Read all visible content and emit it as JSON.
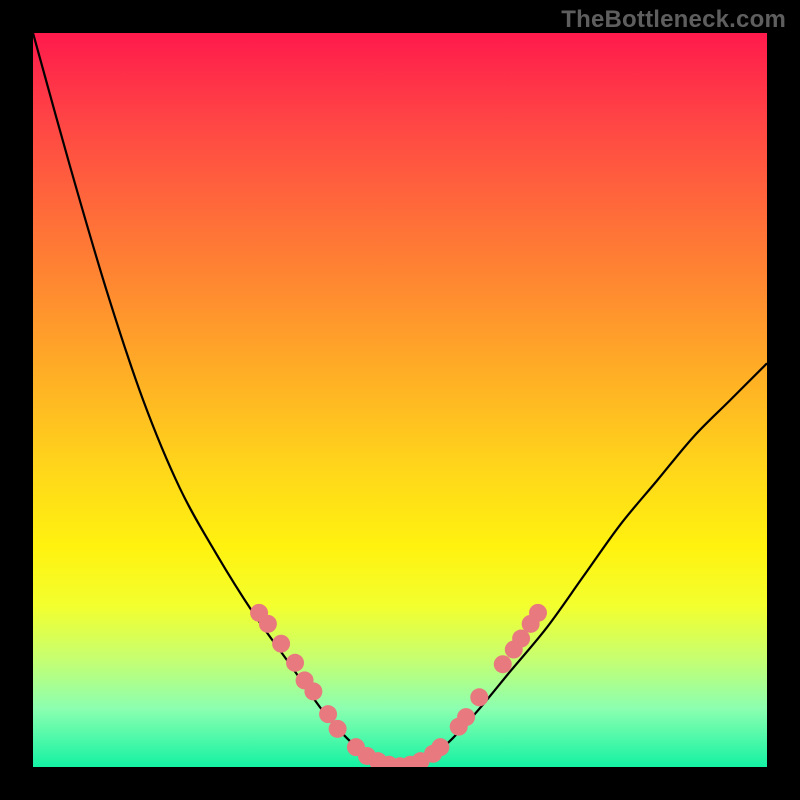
{
  "watermark": {
    "text": "TheBottleneck.com"
  },
  "chart_data": {
    "type": "line",
    "title": "",
    "xlabel": "",
    "ylabel": "",
    "xlim": [
      0,
      1
    ],
    "ylim": [
      0,
      1
    ],
    "x": [
      0.0,
      0.05,
      0.1,
      0.15,
      0.2,
      0.25,
      0.3,
      0.35,
      0.4,
      0.45,
      0.5,
      0.55,
      0.6,
      0.65,
      0.7,
      0.75,
      0.8,
      0.85,
      0.9,
      0.95,
      1.0
    ],
    "y": [
      1.0,
      0.82,
      0.65,
      0.5,
      0.38,
      0.29,
      0.21,
      0.14,
      0.07,
      0.02,
      0.0,
      0.02,
      0.07,
      0.13,
      0.19,
      0.26,
      0.33,
      0.39,
      0.45,
      0.5,
      0.55
    ],
    "series": [
      {
        "name": "curve",
        "type": "line",
        "color": "#000000"
      }
    ],
    "markers": {
      "color": "#e87a7f",
      "radius": 9,
      "points": [
        {
          "x": 0.308,
          "y": 0.21
        },
        {
          "x": 0.32,
          "y": 0.195
        },
        {
          "x": 0.338,
          "y": 0.168
        },
        {
          "x": 0.357,
          "y": 0.142
        },
        {
          "x": 0.37,
          "y": 0.118
        },
        {
          "x": 0.382,
          "y": 0.103
        },
        {
          "x": 0.402,
          "y": 0.072
        },
        {
          "x": 0.415,
          "y": 0.052
        },
        {
          "x": 0.44,
          "y": 0.027
        },
        {
          "x": 0.455,
          "y": 0.015
        },
        {
          "x": 0.47,
          "y": 0.008
        },
        {
          "x": 0.485,
          "y": 0.003
        },
        {
          "x": 0.5,
          "y": 0.001
        },
        {
          "x": 0.514,
          "y": 0.003
        },
        {
          "x": 0.528,
          "y": 0.008
        },
        {
          "x": 0.545,
          "y": 0.018
        },
        {
          "x": 0.555,
          "y": 0.027
        },
        {
          "x": 0.58,
          "y": 0.055
        },
        {
          "x": 0.59,
          "y": 0.068
        },
        {
          "x": 0.608,
          "y": 0.095
        },
        {
          "x": 0.64,
          "y": 0.14
        },
        {
          "x": 0.655,
          "y": 0.16
        },
        {
          "x": 0.665,
          "y": 0.175
        },
        {
          "x": 0.678,
          "y": 0.195
        },
        {
          "x": 0.688,
          "y": 0.21
        }
      ]
    },
    "grid": false,
    "legend": null
  }
}
